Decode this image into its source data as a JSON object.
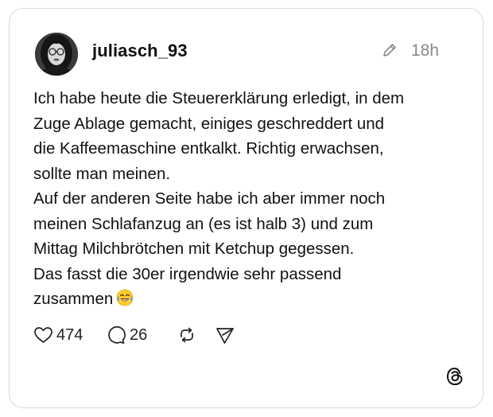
{
  "post": {
    "username": "juliasch_93",
    "timestamp": "18h",
    "lines": [
      "Ich habe heute die Steuererklärung erledigt, in dem",
      "Zuge Ablage gemacht, einiges geschreddert und",
      "die Kaffeemaschine entkalkt. Richtig erwachsen,",
      "sollte man meinen.",
      "Auf der anderen Seite habe ich aber immer noch",
      "meinen Schlafanzug an (es ist halb 3) und zum",
      "Mittag Milchbrötchen mit Ketchup gegessen.",
      "Das fasst die 30er irgendwie sehr passend",
      "zusammen"
    ],
    "emoji": "tears-of-joy-emoji"
  },
  "actions": {
    "likes": "474",
    "replies": "26"
  },
  "icons": {
    "edit": "pencil-icon",
    "like": "heart-icon",
    "reply": "comment-icon",
    "repost": "repost-icon",
    "share": "send-icon",
    "brand": "threads-logo-icon"
  },
  "colors": {
    "text": "#111111",
    "muted": "#8a8a8a",
    "border": "#d9d9d9"
  }
}
